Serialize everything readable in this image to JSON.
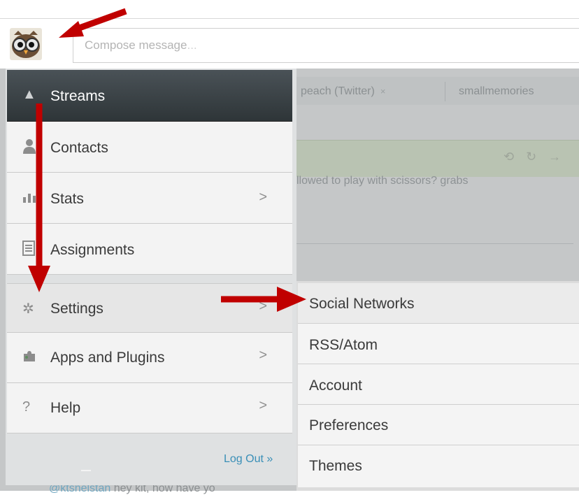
{
  "compose": {
    "placeholder": "Compose message",
    "trailing": "..."
  },
  "background": {
    "tabs": [
      {
        "label": "peach (Twitter)",
        "close": "×"
      },
      {
        "label": "smallmemories"
      }
    ],
    "stream_icons": "⟲ ↻ →",
    "tweet_fragment": "llowed to play with scissors? grabs",
    "bottom_tweet_link": "@ktsnelstan",
    "bottom_tweet_rest": " hey kit, how have yo"
  },
  "menu": {
    "items": [
      {
        "label": "Streams",
        "icon": "streams-up-arrow-icon",
        "has_submenu": false
      },
      {
        "label": "Contacts",
        "icon": "person-icon",
        "has_submenu": false
      },
      {
        "label": "Stats",
        "icon": "bar-chart-icon",
        "has_submenu": true
      },
      {
        "label": "Assignments",
        "icon": "checklist-icon",
        "has_submenu": false
      },
      {
        "label": "Settings",
        "icon": "gear-icon",
        "has_submenu": true
      },
      {
        "label": "Apps and Plugins",
        "icon": "puzzle-icon",
        "has_submenu": true
      },
      {
        "label": "Help",
        "icon": "question-icon",
        "has_submenu": true
      }
    ],
    "chevron": ">",
    "logout_label": "Log Out »"
  },
  "submenu": {
    "items": [
      {
        "label": "Social Networks"
      },
      {
        "label": "RSS/Atom"
      },
      {
        "label": "Account"
      },
      {
        "label": "Preferences"
      },
      {
        "label": "Themes"
      }
    ]
  },
  "colors": {
    "menu_active_bg": "#3a4246",
    "logout_link": "#3a8fb7",
    "annotation_arrow": "#c00000"
  }
}
